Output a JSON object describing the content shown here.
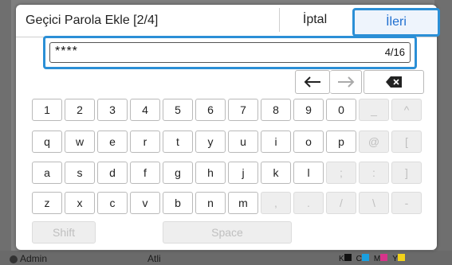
{
  "dialog": {
    "title": "Geçici Parola Ekle [2/4]",
    "cancel_label": "İptal",
    "next_label": "İleri"
  },
  "input": {
    "value": "****",
    "counter": "4/16"
  },
  "nav": {
    "left_icon": "arrow-left-icon",
    "right_icon": "arrow-right-icon",
    "backspace_icon": "backspace-icon"
  },
  "keyboard": {
    "row1": [
      "1",
      "2",
      "3",
      "4",
      "5",
      "6",
      "7",
      "8",
      "9",
      "0",
      "_",
      "^"
    ],
    "row2": [
      "q",
      "w",
      "e",
      "r",
      "t",
      "y",
      "u",
      "i",
      "o",
      "p",
      "@",
      "["
    ],
    "row3": [
      "a",
      "s",
      "d",
      "f",
      "g",
      "h",
      "j",
      "k",
      "l",
      ";",
      ":",
      "]"
    ],
    "row4": [
      "z",
      "x",
      "c",
      "v",
      "b",
      "n",
      "m",
      ",",
      ".",
      "/",
      "\\",
      "-"
    ],
    "shift_label": "Shift",
    "space_label": "Space"
  },
  "background": {
    "user_label": "Admin",
    "center_label": "Atli",
    "ink_labels": [
      "K",
      "C",
      "M",
      "Y"
    ],
    "ink_colors": [
      "#111111",
      "#1aa0e0",
      "#d6338a",
      "#f2d21a"
    ]
  }
}
